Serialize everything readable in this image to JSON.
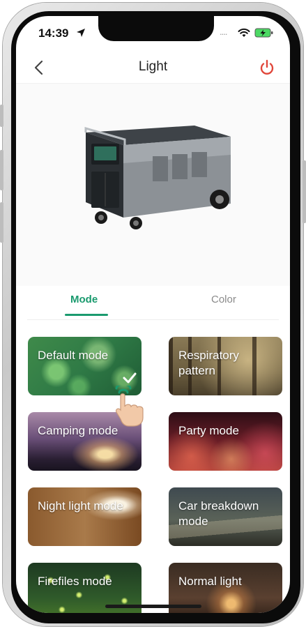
{
  "status_bar": {
    "time": "14:39",
    "signal": "....",
    "icons": [
      "location-arrow-icon",
      "wifi-icon",
      "battery-charging-icon"
    ]
  },
  "header": {
    "title": "Light",
    "back_icon": "chevron-left-icon",
    "power_icon": "power-icon",
    "power_color": "#e0463a"
  },
  "product": {
    "image": "portable-power-station"
  },
  "tabs": [
    {
      "label": "Mode",
      "active": true
    },
    {
      "label": "Color",
      "active": false
    }
  ],
  "accent_color": "#1a9a6e",
  "modes": [
    {
      "label": "Default mode",
      "selected": true
    },
    {
      "label": "Respiratory pattern",
      "selected": false
    },
    {
      "label": "Camping mode",
      "selected": false
    },
    {
      "label": "Party mode",
      "selected": false
    },
    {
      "label": "Night light mode",
      "selected": false
    },
    {
      "label": "Car breakdown mode",
      "selected": false
    },
    {
      "label": "Firefiles mode",
      "selected": false
    },
    {
      "label": "Normal light",
      "selected": false
    }
  ]
}
